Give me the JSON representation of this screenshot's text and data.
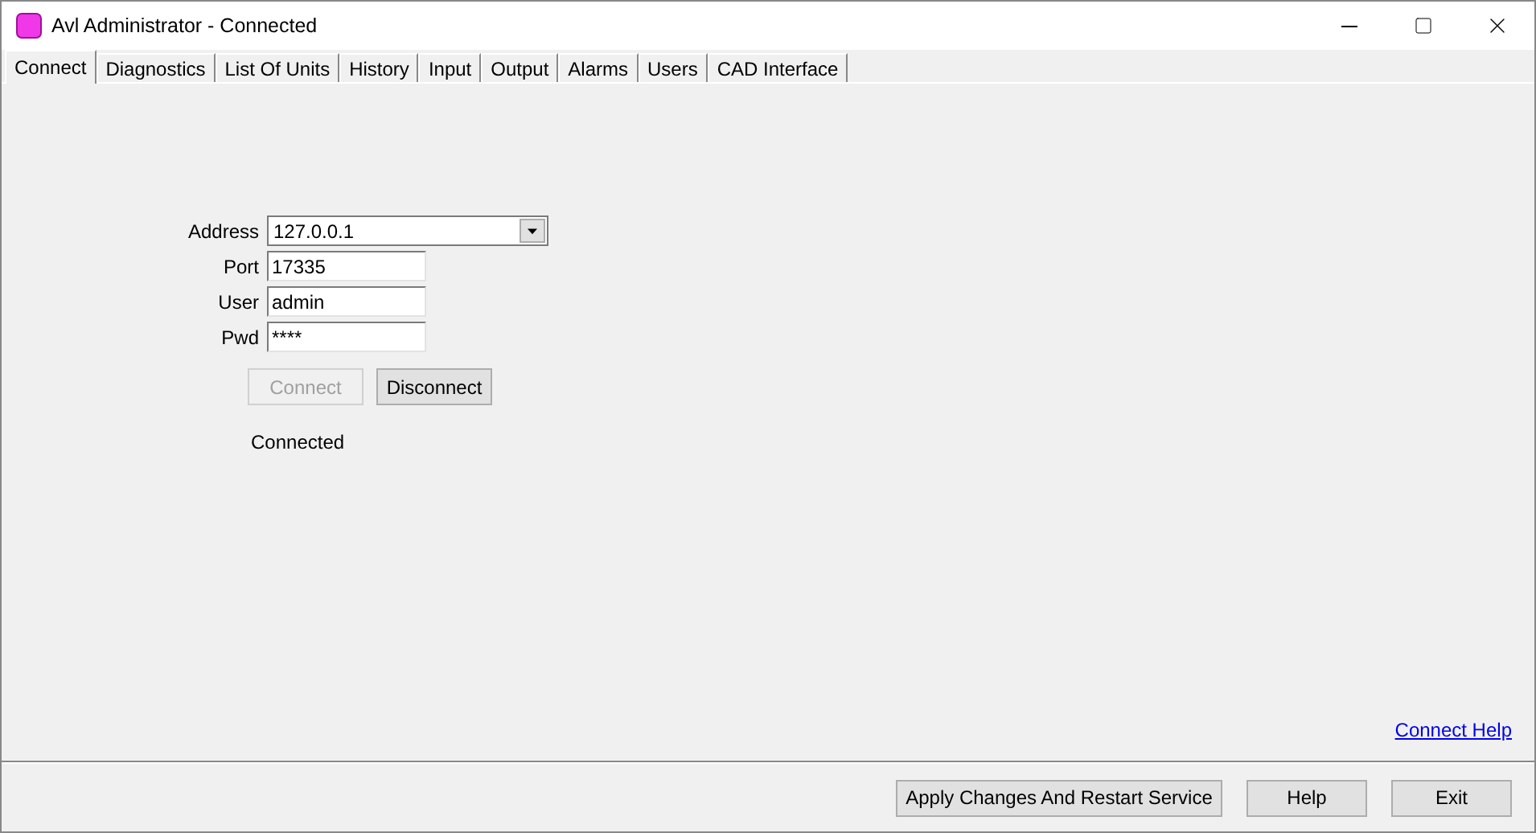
{
  "window": {
    "title": "Avl Administrator - Connected"
  },
  "tabs": [
    {
      "label": "Connect",
      "selected": true
    },
    {
      "label": "Diagnostics",
      "selected": false
    },
    {
      "label": "List Of Units",
      "selected": false
    },
    {
      "label": "History",
      "selected": false
    },
    {
      "label": "Input",
      "selected": false
    },
    {
      "label": "Output",
      "selected": false
    },
    {
      "label": "Alarms",
      "selected": false
    },
    {
      "label": "Users",
      "selected": false
    },
    {
      "label": "CAD Interface",
      "selected": false
    }
  ],
  "form": {
    "fields": [
      {
        "label": "Address",
        "value": "127.0.0.1",
        "kind": "combo"
      },
      {
        "label": "Port",
        "value": "17335",
        "kind": "text"
      },
      {
        "label": "User",
        "value": "admin",
        "kind": "text"
      },
      {
        "label": "Pwd",
        "value": "****",
        "kind": "text"
      }
    ],
    "buttons": [
      {
        "label": "Connect",
        "disabled": true
      },
      {
        "label": "Disconnect",
        "disabled": false
      }
    ],
    "status": "Connected"
  },
  "help_link": "Connect Help",
  "footer_buttons": [
    "Apply Changes And Restart Service",
    "Help",
    "Exit"
  ]
}
